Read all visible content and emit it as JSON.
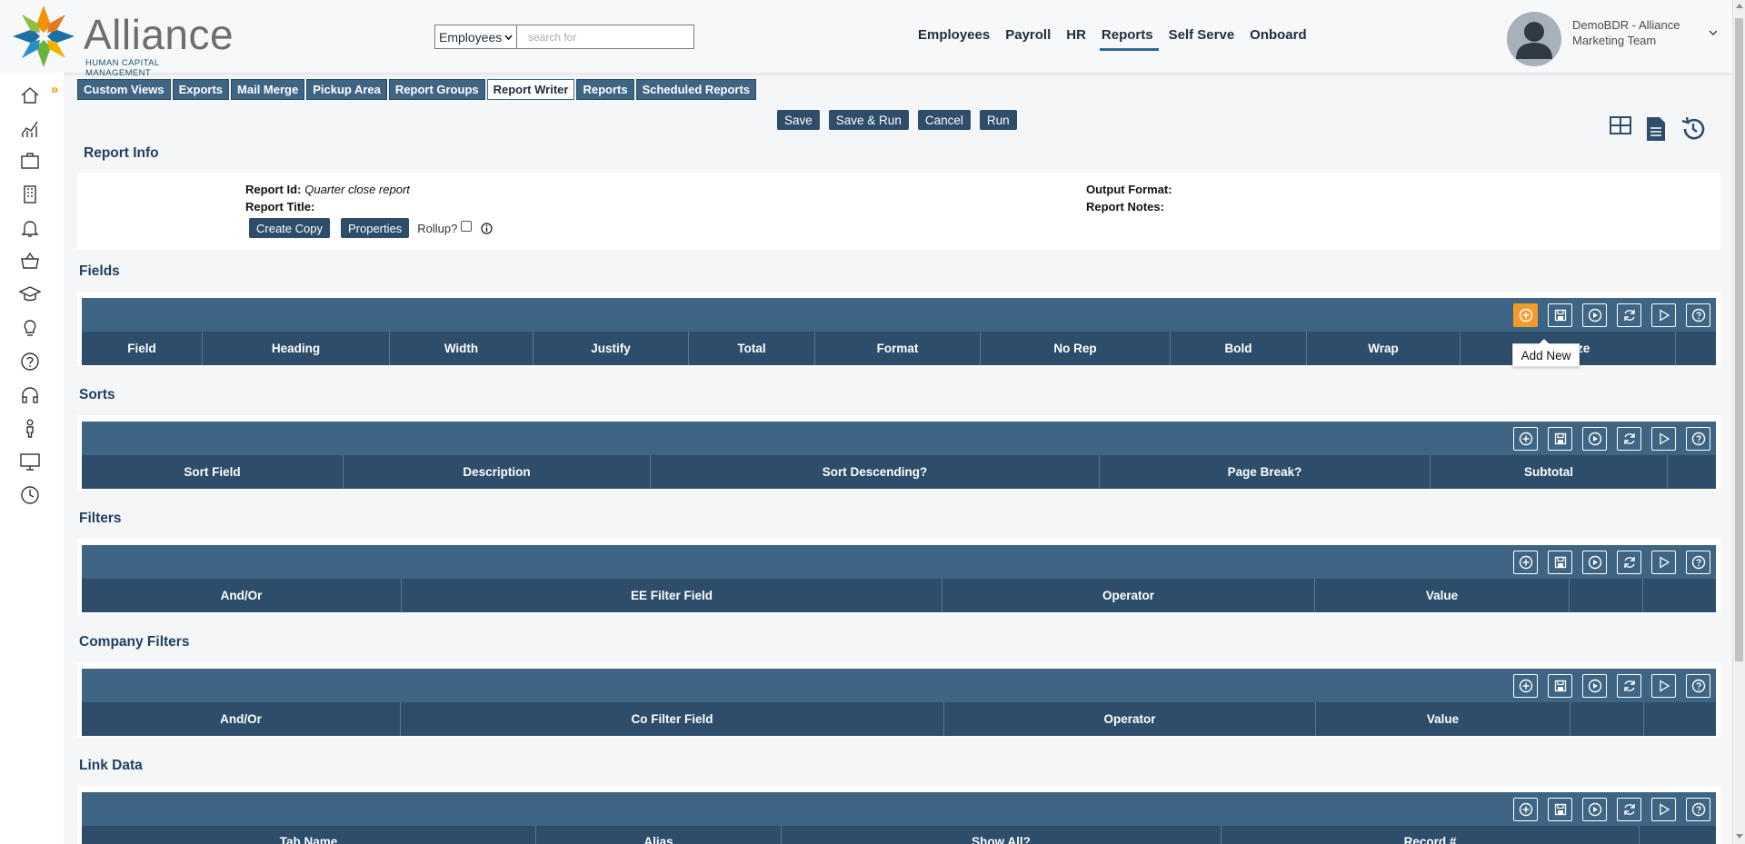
{
  "brand": {
    "name": "Alliance",
    "tagline": "HUMAN CAPITAL MANAGEMENT"
  },
  "search": {
    "scope": "Employees",
    "placeholder": "search for"
  },
  "topnav": [
    "Employees",
    "Payroll",
    "HR",
    "Reports",
    "Self Serve",
    "Onboard"
  ],
  "topnav_active": "Reports",
  "user": {
    "line1": "DemoBDR - Alliance",
    "line2": "Marketing Team"
  },
  "subtabs": [
    "Custom Views",
    "Exports",
    "Mail Merge",
    "Pickup Area",
    "Report Groups",
    "Report Writer",
    "Reports",
    "Scheduled Reports"
  ],
  "subtab_active": "Report Writer",
  "actions": {
    "save": "Save",
    "save_run": "Save & Run",
    "cancel": "Cancel",
    "run": "Run"
  },
  "report_info": {
    "title": "Report Info",
    "id_label": "Report Id:",
    "id_value": "Quarter close report",
    "title_label": "Report Title:",
    "output_label": "Output Format:",
    "notes_label": "Report Notes:",
    "create_copy": "Create Copy",
    "properties": "Properties",
    "rollup": "Rollup?"
  },
  "sections": {
    "fields": {
      "title": "Fields",
      "columns": [
        "Field",
        "Heading",
        "Width",
        "Justify",
        "Total",
        "Format",
        "No Rep",
        "Bold",
        "Wrap",
        "ze",
        ""
      ]
    },
    "sorts": {
      "title": "Sorts",
      "columns": [
        "Sort Field",
        "Description",
        "Sort Descending?",
        "Page Break?",
        "Subtotal",
        ""
      ]
    },
    "filters": {
      "title": "Filters",
      "columns": [
        "And/Or",
        "EE Filter Field",
        "Operator",
        "Value",
        "",
        ""
      ]
    },
    "company_filters": {
      "title": "Company Filters",
      "columns": [
        "And/Or",
        "Co Filter Field",
        "Operator",
        "Value",
        "",
        ""
      ]
    },
    "link_data": {
      "title": "Link Data",
      "columns": [
        "Tab Name",
        "Alias",
        "Show All?",
        "Record #",
        ""
      ]
    }
  },
  "tooltip": "Add New",
  "accent": {
    "header_bar": "#3e6584",
    "column_bar": "#2d4d6b",
    "hot": "#f39c2c",
    "brand_orange": "#f39200"
  }
}
